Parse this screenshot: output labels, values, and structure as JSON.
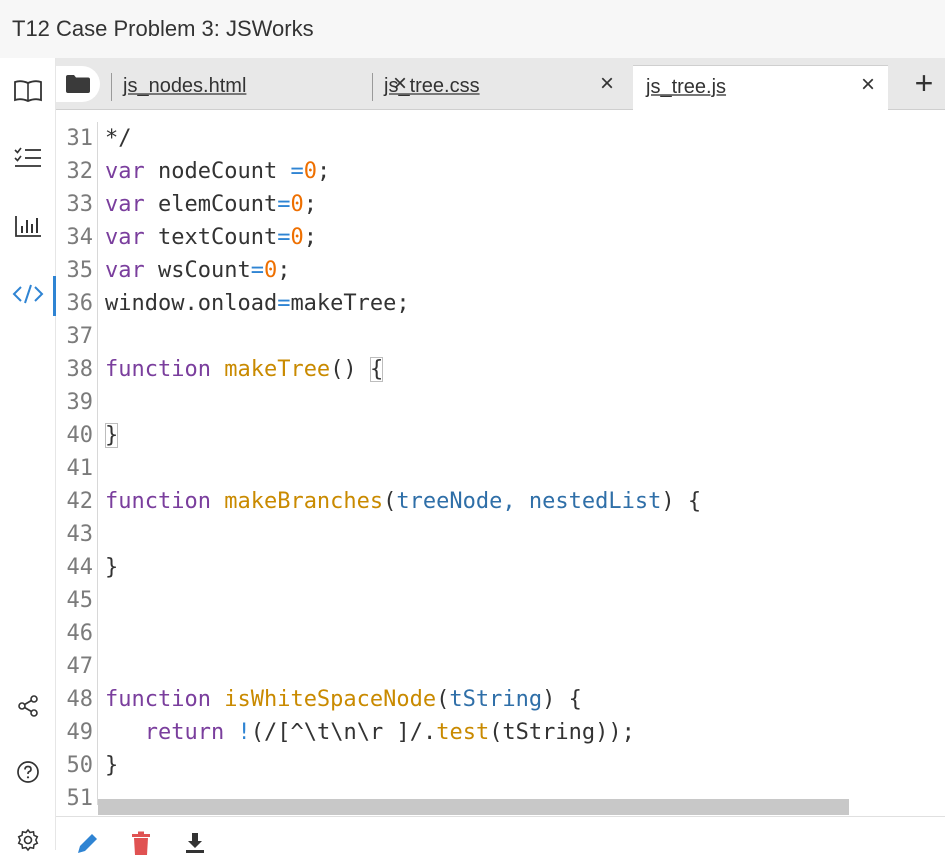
{
  "window": {
    "title": "T12 Case Problem 3: JSWorks"
  },
  "sidebar": {
    "top_icons": [
      "book-icon",
      "checklist-icon",
      "bar-chart-icon",
      "code-icon"
    ],
    "bottom_icons": [
      "share-icon",
      "help-icon",
      "settings-icon"
    ]
  },
  "tabs": [
    {
      "label": "js_nodes.html",
      "active": false
    },
    {
      "label": "js_tree.css",
      "active": false
    },
    {
      "label": "js_tree.js",
      "active": true
    }
  ],
  "tab_close_glyph": "×",
  "add_tab_glyph": "+",
  "editor": {
    "lines": [
      {
        "num": "31"
      },
      {
        "num": "32"
      },
      {
        "num": "33"
      },
      {
        "num": "34"
      },
      {
        "num": "35"
      },
      {
        "num": "36"
      },
      {
        "num": "37"
      },
      {
        "num": "38"
      },
      {
        "num": "39"
      },
      {
        "num": "40"
      },
      {
        "num": "41"
      },
      {
        "num": "42"
      },
      {
        "num": "43"
      },
      {
        "num": "44"
      },
      {
        "num": "45"
      },
      {
        "num": "46"
      },
      {
        "num": "47"
      },
      {
        "num": "48"
      },
      {
        "num": "49"
      },
      {
        "num": "50"
      },
      {
        "num": "51"
      }
    ],
    "code": {
      "l31": "*/",
      "kw_var": "var",
      "kw_function": "function",
      "kw_return": "return",
      "node_count": " nodeCount ",
      "elem_count": " elemCount",
      "text_count": " textCount",
      "ws_count": " wsCount",
      "eq": "=",
      "zero": "0",
      "semi": ";",
      "l36": "window.onload",
      "l36b": "makeTree;",
      "make_tree": "makeTree",
      "parens": "() ",
      "open_brace": "{",
      "close_brace": "}",
      "make_branches": "makeBranches",
      "open_paren": "(",
      "tree_node": "treeNode",
      "comma": ", ",
      "nested_list": "nestedList",
      "close_paren_brace": ") {",
      "is_ws_node": "isWhiteSpaceNode",
      "t_string": "tString",
      "bang": "!",
      "regex_a": "(/[",
      "regex_b": "^\\t\\n\\r ",
      "regex_c": "]/.",
      "test": "test",
      "l49_tail": "(tString));"
    }
  },
  "toolbar": {
    "icons": [
      "pencil-icon",
      "trash-icon",
      "download-icon"
    ]
  },
  "colors": {
    "keyword": "#7a3e9d",
    "function": "#c98a00",
    "number": "#ee6f00",
    "param": "#2f6fa8",
    "accent": "#2f84d3"
  }
}
